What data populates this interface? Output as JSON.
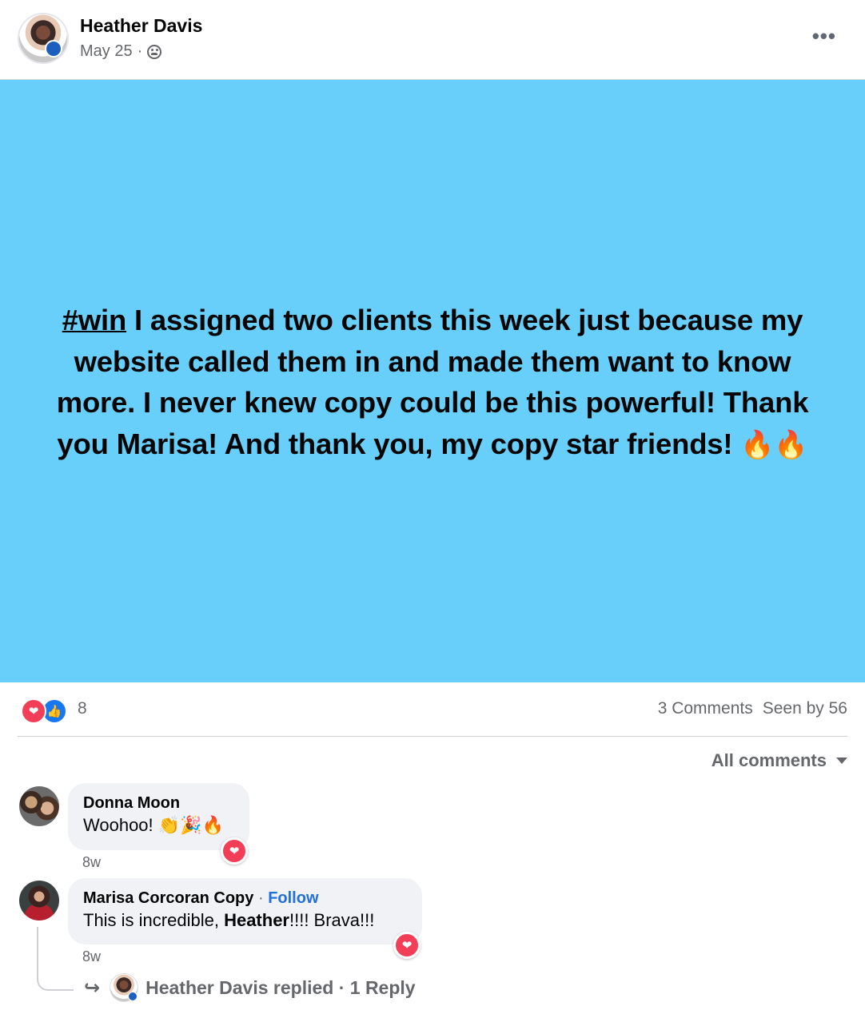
{
  "post": {
    "author": "Heather Davis",
    "date": "May 25",
    "date_sep": "·",
    "privacy_icon": "group-icon",
    "more_label": "•••",
    "hashtag": "#win",
    "body": " I assigned two clients this week just because my website called them in and made them want to know more. I never knew copy could be this powerful! Thank you Marisa! And thank you, my copy star friends! ",
    "emoji": "🔥🔥",
    "background_color": "#67cffa"
  },
  "stats": {
    "reaction_icons": [
      "love-icon",
      "like-icon"
    ],
    "reaction_count": "8",
    "comments": "3 Comments",
    "seen_by": "Seen by 56"
  },
  "comment_filter": {
    "label": "All comments"
  },
  "comments": [
    {
      "author": "Donna Moon",
      "text": "Woohoo! 👏🎉🔥",
      "time": "8w",
      "reaction": "love-icon"
    },
    {
      "author": "Marisa Corcoran Copy",
      "follow_sep": "·",
      "follow": "Follow",
      "text_before": "This is incredible, ",
      "text_bold": "Heather",
      "text_after": "!!!! Brava!!!",
      "time": "8w",
      "reaction": "love-icon"
    }
  ],
  "reply": {
    "arrow": "↪",
    "text": "Heather Davis replied · 1 Reply"
  }
}
